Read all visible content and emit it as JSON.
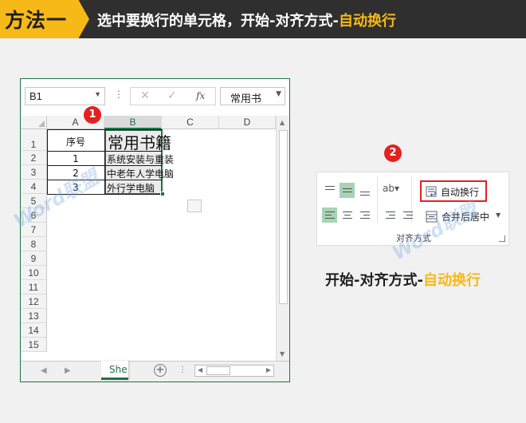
{
  "banner": {
    "method_tag": "方法一",
    "title_main": "选中要换行的单元格，开始-对齐方式-",
    "title_highlight": "自动换行"
  },
  "excel": {
    "name_box": "B1",
    "font_name": "常用书",
    "columns": [
      "A",
      "B",
      "C",
      "D"
    ],
    "rows": [
      "1",
      "2",
      "3",
      "4",
      "5",
      "6",
      "7",
      "8",
      "9",
      "10",
      "11",
      "12",
      "13",
      "14",
      "15"
    ],
    "cells": {
      "A1": "序号",
      "B1": "常用书籍",
      "A2": "1",
      "B2": "系统安装与重装",
      "A3": "2",
      "B3": "中老年人学电脑",
      "A4": "3",
      "B4": "外行学电脑"
    },
    "sheet_tab": "She"
  },
  "ribbon": {
    "wrap_text_label": "自动换行",
    "merge_label": "合并后居中",
    "group_label": "对齐方式"
  },
  "steps": {
    "one": "1",
    "two": "2"
  },
  "caption": {
    "main": "开始-对齐方式-",
    "highlight": "自动换行"
  },
  "watermark": "Word联盟",
  "colors": {
    "accent_yellow": "#f6b918",
    "excel_green": "#217346",
    "badge_red": "#e52020",
    "banner_dark": "#2f2f2f"
  }
}
